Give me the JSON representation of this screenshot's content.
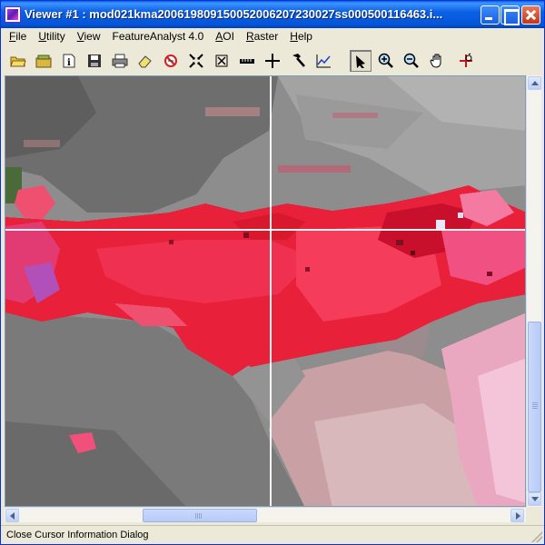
{
  "window": {
    "title": "Viewer #1 : mod021kma20061980915005200620723002 7ss000500116463.i...",
    "title_exact": "Viewer #1 : mod021kma200619809150052006207230027ss000500116463.i..."
  },
  "menubar": {
    "items": [
      {
        "hotkey": "F",
        "rest": "ile"
      },
      {
        "hotkey": "U",
        "rest": "tility"
      },
      {
        "hotkey": "V",
        "rest": "iew"
      },
      {
        "hotkey": "",
        "rest": "FeatureAnalyst 4.0"
      },
      {
        "hotkey": "A",
        "rest": "OI"
      },
      {
        "hotkey": "R",
        "rest": "aster"
      },
      {
        "hotkey": "H",
        "rest": "elp"
      }
    ]
  },
  "toolbar": {
    "tools": [
      "open-folder-icon",
      "open-layer-icon",
      "info-icon",
      "save-icon",
      "print-icon",
      "eraser-icon",
      "no-entry-icon",
      "shrink-icon",
      "fit-icon",
      "ruler-icon",
      "crosshair-icon",
      "hammer-icon",
      "profile-icon",
      "select-arrow-icon",
      "zoom-in-icon",
      "zoom-out-icon",
      "pan-hand-icon",
      "inquire-cursor-icon"
    ],
    "pressed_tool": "select-arrow-icon"
  },
  "status": {
    "text": "Close Cursor Information Dialog"
  },
  "colors": {
    "titlebar": "#0454d8",
    "smoke_red": "#e8203a",
    "smoke_pink": "#f07aa0",
    "ground_gray": "#8a8a8a"
  }
}
